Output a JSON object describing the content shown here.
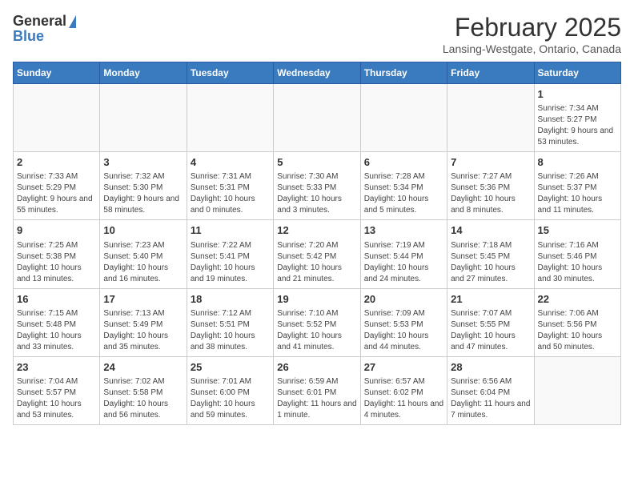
{
  "header": {
    "logo_general": "General",
    "logo_blue": "Blue",
    "month_title": "February 2025",
    "location": "Lansing-Westgate, Ontario, Canada"
  },
  "calendar": {
    "days_of_week": [
      "Sunday",
      "Monday",
      "Tuesday",
      "Wednesday",
      "Thursday",
      "Friday",
      "Saturday"
    ],
    "weeks": [
      [
        {
          "day": "",
          "info": ""
        },
        {
          "day": "",
          "info": ""
        },
        {
          "day": "",
          "info": ""
        },
        {
          "day": "",
          "info": ""
        },
        {
          "day": "",
          "info": ""
        },
        {
          "day": "",
          "info": ""
        },
        {
          "day": "1",
          "info": "Sunrise: 7:34 AM\nSunset: 5:27 PM\nDaylight: 9 hours and 53 minutes."
        }
      ],
      [
        {
          "day": "2",
          "info": "Sunrise: 7:33 AM\nSunset: 5:29 PM\nDaylight: 9 hours and 55 minutes."
        },
        {
          "day": "3",
          "info": "Sunrise: 7:32 AM\nSunset: 5:30 PM\nDaylight: 9 hours and 58 minutes."
        },
        {
          "day": "4",
          "info": "Sunrise: 7:31 AM\nSunset: 5:31 PM\nDaylight: 10 hours and 0 minutes."
        },
        {
          "day": "5",
          "info": "Sunrise: 7:30 AM\nSunset: 5:33 PM\nDaylight: 10 hours and 3 minutes."
        },
        {
          "day": "6",
          "info": "Sunrise: 7:28 AM\nSunset: 5:34 PM\nDaylight: 10 hours and 5 minutes."
        },
        {
          "day": "7",
          "info": "Sunrise: 7:27 AM\nSunset: 5:36 PM\nDaylight: 10 hours and 8 minutes."
        },
        {
          "day": "8",
          "info": "Sunrise: 7:26 AM\nSunset: 5:37 PM\nDaylight: 10 hours and 11 minutes."
        }
      ],
      [
        {
          "day": "9",
          "info": "Sunrise: 7:25 AM\nSunset: 5:38 PM\nDaylight: 10 hours and 13 minutes."
        },
        {
          "day": "10",
          "info": "Sunrise: 7:23 AM\nSunset: 5:40 PM\nDaylight: 10 hours and 16 minutes."
        },
        {
          "day": "11",
          "info": "Sunrise: 7:22 AM\nSunset: 5:41 PM\nDaylight: 10 hours and 19 minutes."
        },
        {
          "day": "12",
          "info": "Sunrise: 7:20 AM\nSunset: 5:42 PM\nDaylight: 10 hours and 21 minutes."
        },
        {
          "day": "13",
          "info": "Sunrise: 7:19 AM\nSunset: 5:44 PM\nDaylight: 10 hours and 24 minutes."
        },
        {
          "day": "14",
          "info": "Sunrise: 7:18 AM\nSunset: 5:45 PM\nDaylight: 10 hours and 27 minutes."
        },
        {
          "day": "15",
          "info": "Sunrise: 7:16 AM\nSunset: 5:46 PM\nDaylight: 10 hours and 30 minutes."
        }
      ],
      [
        {
          "day": "16",
          "info": "Sunrise: 7:15 AM\nSunset: 5:48 PM\nDaylight: 10 hours and 33 minutes."
        },
        {
          "day": "17",
          "info": "Sunrise: 7:13 AM\nSunset: 5:49 PM\nDaylight: 10 hours and 35 minutes."
        },
        {
          "day": "18",
          "info": "Sunrise: 7:12 AM\nSunset: 5:51 PM\nDaylight: 10 hours and 38 minutes."
        },
        {
          "day": "19",
          "info": "Sunrise: 7:10 AM\nSunset: 5:52 PM\nDaylight: 10 hours and 41 minutes."
        },
        {
          "day": "20",
          "info": "Sunrise: 7:09 AM\nSunset: 5:53 PM\nDaylight: 10 hours and 44 minutes."
        },
        {
          "day": "21",
          "info": "Sunrise: 7:07 AM\nSunset: 5:55 PM\nDaylight: 10 hours and 47 minutes."
        },
        {
          "day": "22",
          "info": "Sunrise: 7:06 AM\nSunset: 5:56 PM\nDaylight: 10 hours and 50 minutes."
        }
      ],
      [
        {
          "day": "23",
          "info": "Sunrise: 7:04 AM\nSunset: 5:57 PM\nDaylight: 10 hours and 53 minutes."
        },
        {
          "day": "24",
          "info": "Sunrise: 7:02 AM\nSunset: 5:58 PM\nDaylight: 10 hours and 56 minutes."
        },
        {
          "day": "25",
          "info": "Sunrise: 7:01 AM\nSunset: 6:00 PM\nDaylight: 10 hours and 59 minutes."
        },
        {
          "day": "26",
          "info": "Sunrise: 6:59 AM\nSunset: 6:01 PM\nDaylight: 11 hours and 1 minute."
        },
        {
          "day": "27",
          "info": "Sunrise: 6:57 AM\nSunset: 6:02 PM\nDaylight: 11 hours and 4 minutes."
        },
        {
          "day": "28",
          "info": "Sunrise: 6:56 AM\nSunset: 6:04 PM\nDaylight: 11 hours and 7 minutes."
        },
        {
          "day": "",
          "info": ""
        }
      ]
    ]
  }
}
